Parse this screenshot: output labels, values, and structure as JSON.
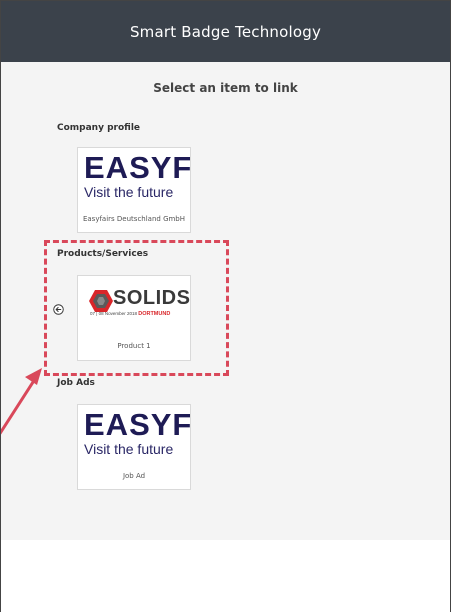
{
  "header": {
    "title": "Smart Badge Technology"
  },
  "instruction": "Select an item to link",
  "sections": {
    "company": {
      "title": "Company profile",
      "card": {
        "logo_main": "EASYFA",
        "logo_tagline": "Visit the future",
        "caption": "Easyfairs Deutschland GmbH"
      }
    },
    "products": {
      "title": "Products/Services",
      "card": {
        "logo_main": "SOLIDS",
        "logo_dates": "07 | 08 November 2018",
        "logo_city": "DORTMUND",
        "caption": "Product 1"
      }
    },
    "jobs": {
      "title": "Job Ads",
      "card": {
        "logo_main": "EASYFA",
        "logo_tagline": "Visit the future",
        "caption": "Job Ad"
      }
    }
  },
  "icons": {
    "back": "circle-arrow-left-icon"
  },
  "colors": {
    "header_bg": "#3b424b",
    "content_bg": "#f4f4f4",
    "easyfairs_navy": "#1e1b55",
    "highlight": "#d9485a",
    "solids_red": "#d9262a"
  }
}
